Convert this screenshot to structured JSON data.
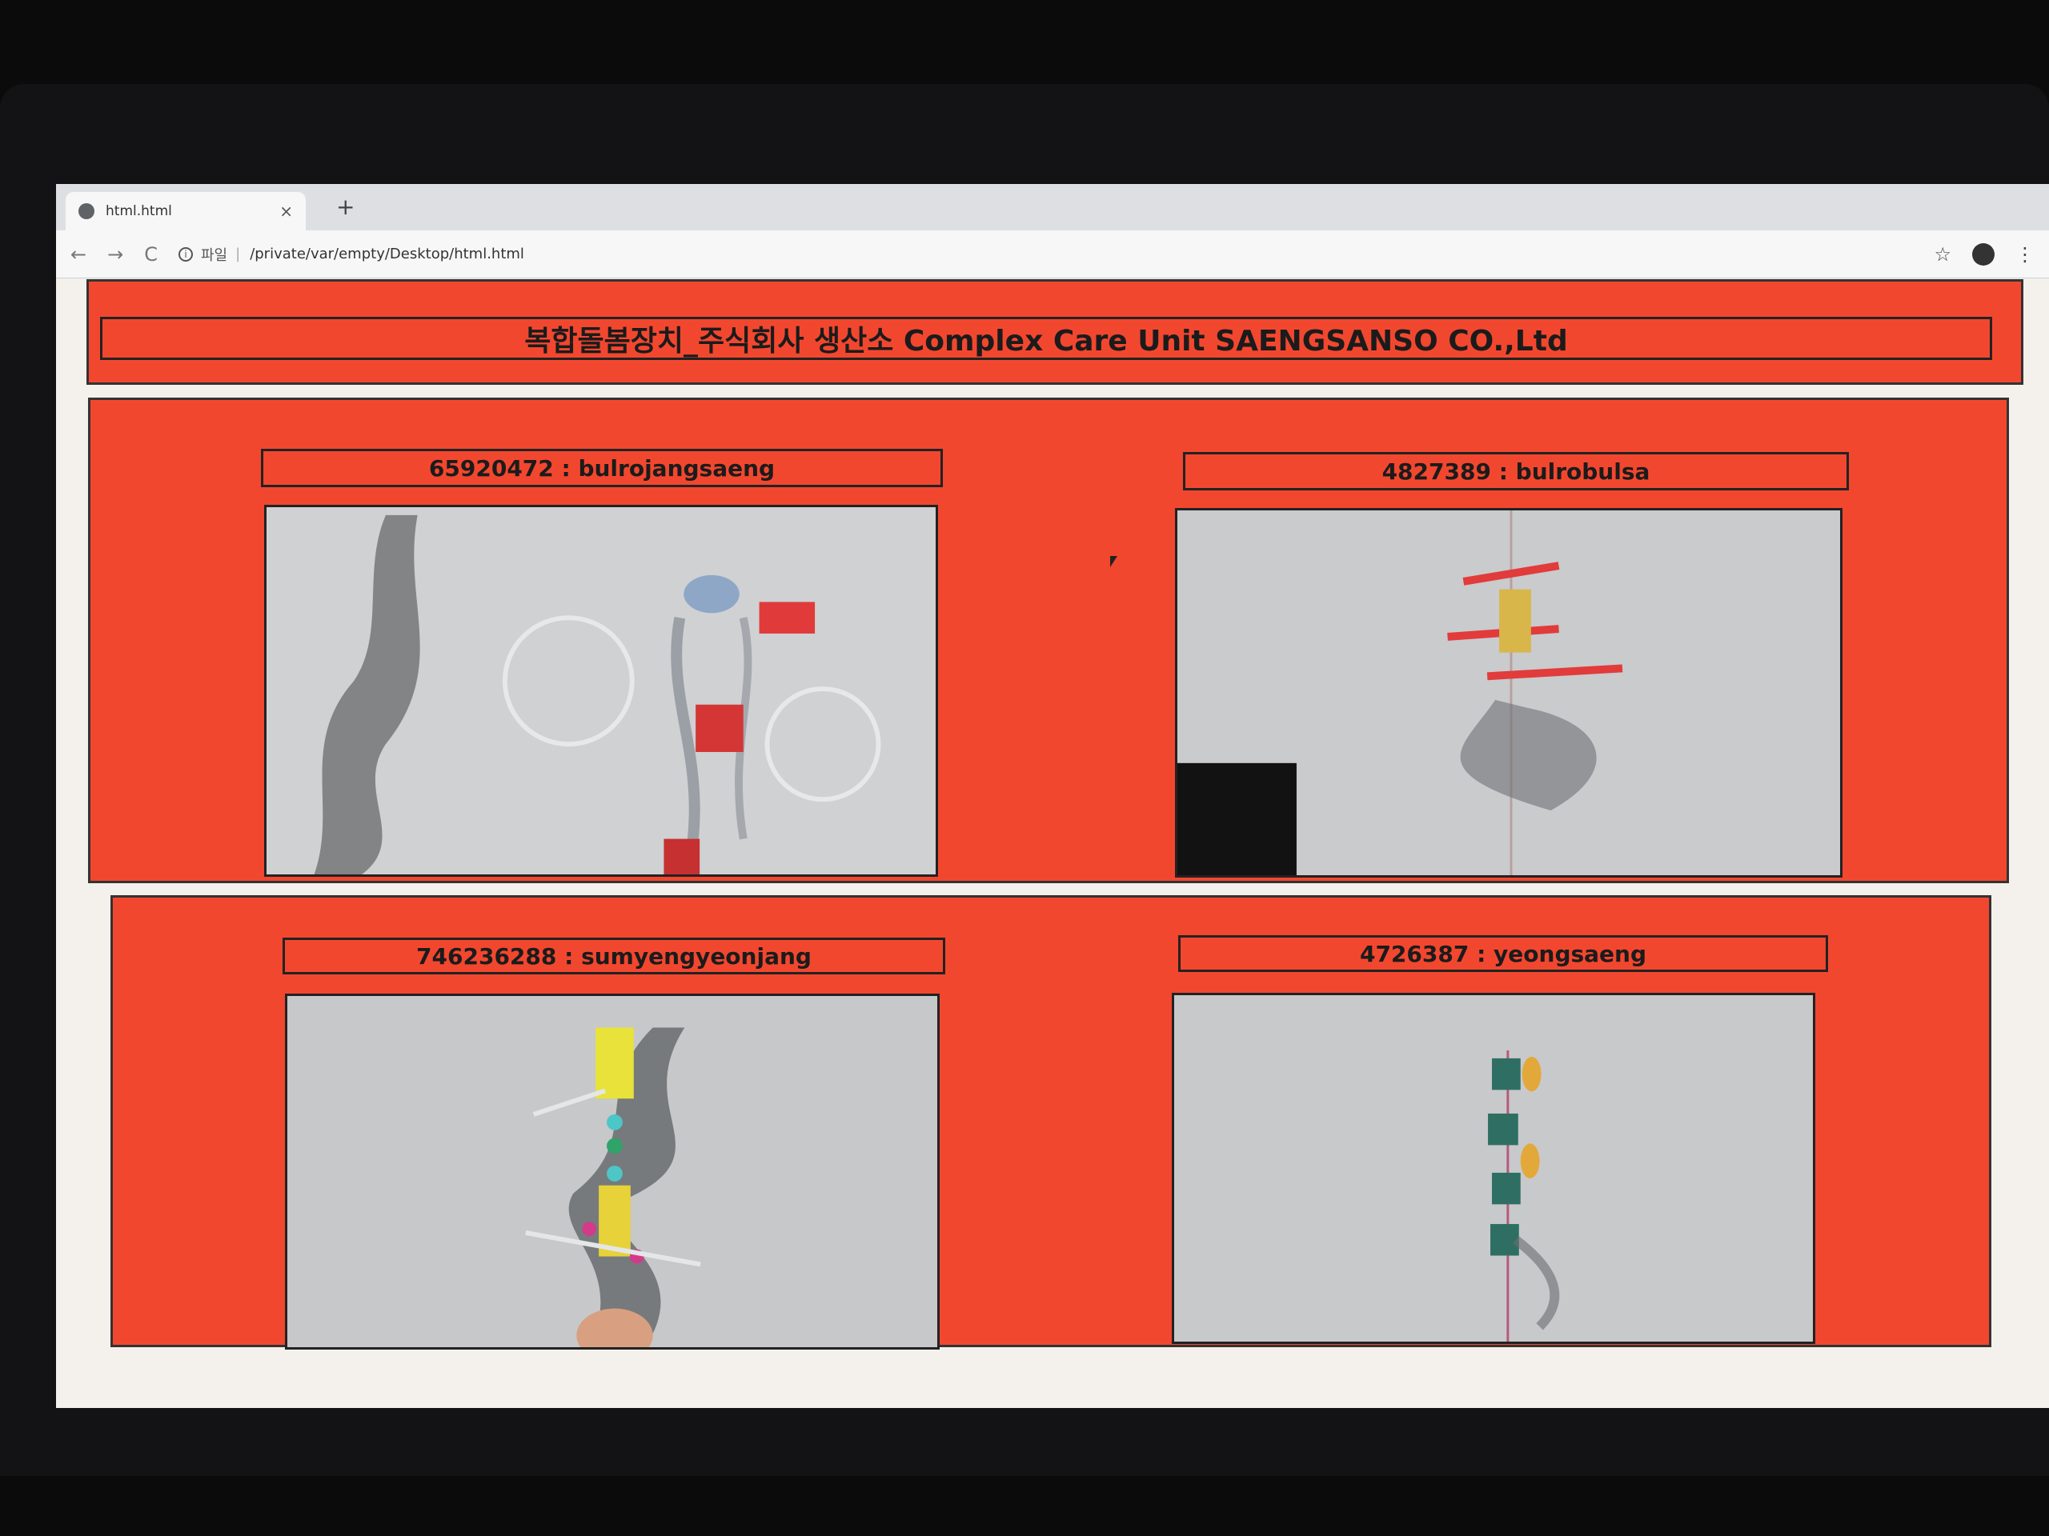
{
  "browser": {
    "tab_title": "html.html",
    "tab_close": "×",
    "new_tab": "+",
    "nav": {
      "back": "←",
      "forward": "→",
      "reload": "C"
    },
    "address": {
      "info_glyph": "i",
      "scheme_label": "파일",
      "separator": "|",
      "path": "/private/var/empty/Desktop/html.html"
    },
    "bookmark_glyph": "☆",
    "menu_glyph": "⋮"
  },
  "page": {
    "title": "복합돌봄장치_주식회사 생산소 Complex Care Unit SAENGSANSO CO.,Ltd",
    "items": [
      {
        "caption": "65920472 : bulrojangsaeng"
      },
      {
        "caption": "4827389 : bulrobulsa"
      },
      {
        "caption": "746236288 : sumyengyeonjang"
      },
      {
        "caption": "4726387 : yeongsaeng"
      }
    ]
  },
  "colors": {
    "page_red": "#f2472f",
    "border": "#222222",
    "text": "#1b1b1b"
  }
}
